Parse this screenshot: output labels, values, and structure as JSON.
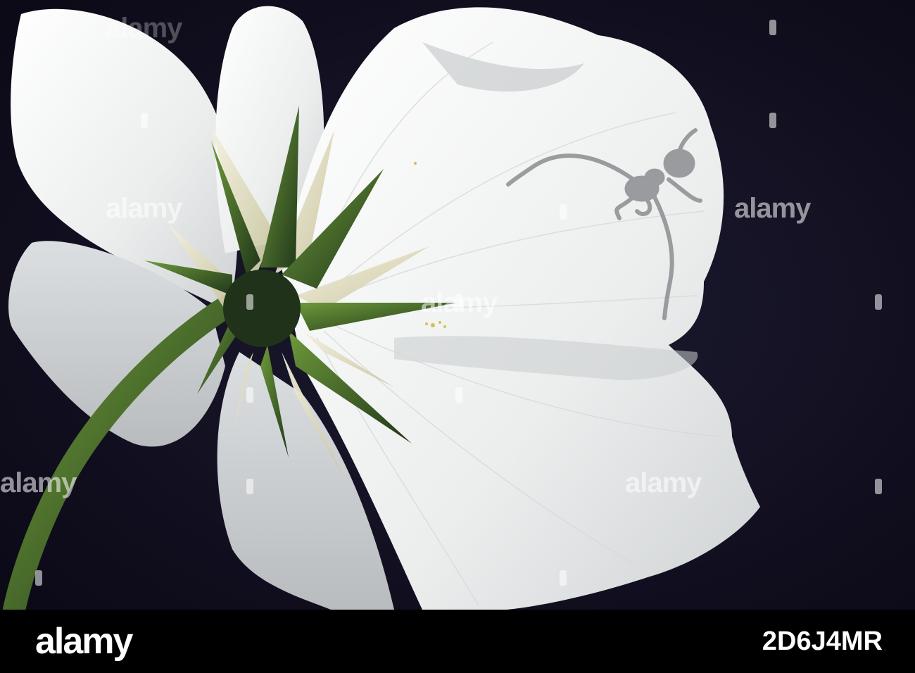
{
  "watermark": {
    "text": "alamy"
  },
  "footer": {
    "logo": "alamy",
    "image_id": "2D6J4MR"
  },
  "colors": {
    "background": "#0f0d1e",
    "petal": "#f2f2f0",
    "sepal": "#3f6a22",
    "stem": "#324a2a",
    "footer": "#000000"
  }
}
